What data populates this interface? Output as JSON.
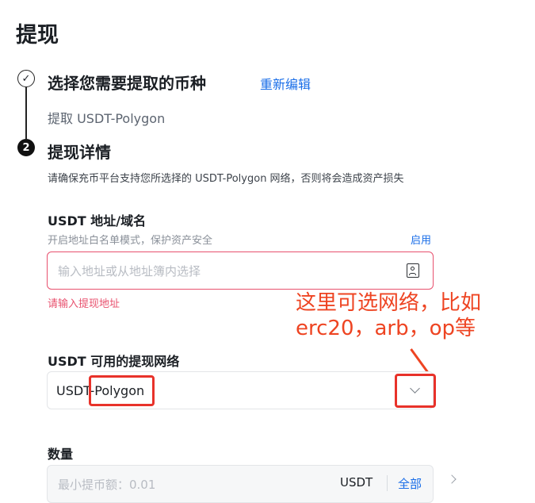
{
  "page": {
    "title": "提现"
  },
  "steps": [
    {
      "number": "✓",
      "title": "选择您需要提取的币种",
      "action": "重新编辑",
      "summary": "提取 USDT-Polygon"
    },
    {
      "number": "2",
      "title": "提现详情",
      "hint": "请确保充币平台支持您所选择的 USDT-Polygon 网络，否则将会造成资产损失"
    }
  ],
  "address": {
    "label": "USDT 地址/域名",
    "whitelist_hint": "开启地址白名单模式，保护资产安全",
    "whitelist_action": "启用",
    "placeholder": "输入地址或从地址簿内选择",
    "value": "",
    "error": "请输入提现地址",
    "icon": "address-book-icon"
  },
  "network": {
    "label": "USDT 可用的提现网络",
    "selected": "USDT-Polygon",
    "icon": "chevron-down-icon"
  },
  "annotation": {
    "line1": "这里可选网络，比如",
    "line2": "erc20，arb，op等",
    "color": "#ee4422"
  },
  "quantity": {
    "label": "数量",
    "placeholder": "最小提币额：0.01",
    "value": "",
    "unit": "USDT",
    "max_action": "全部"
  },
  "colors": {
    "accent": "#1a6ee8",
    "error": "#e8516e",
    "highlight": "#e8322a"
  }
}
